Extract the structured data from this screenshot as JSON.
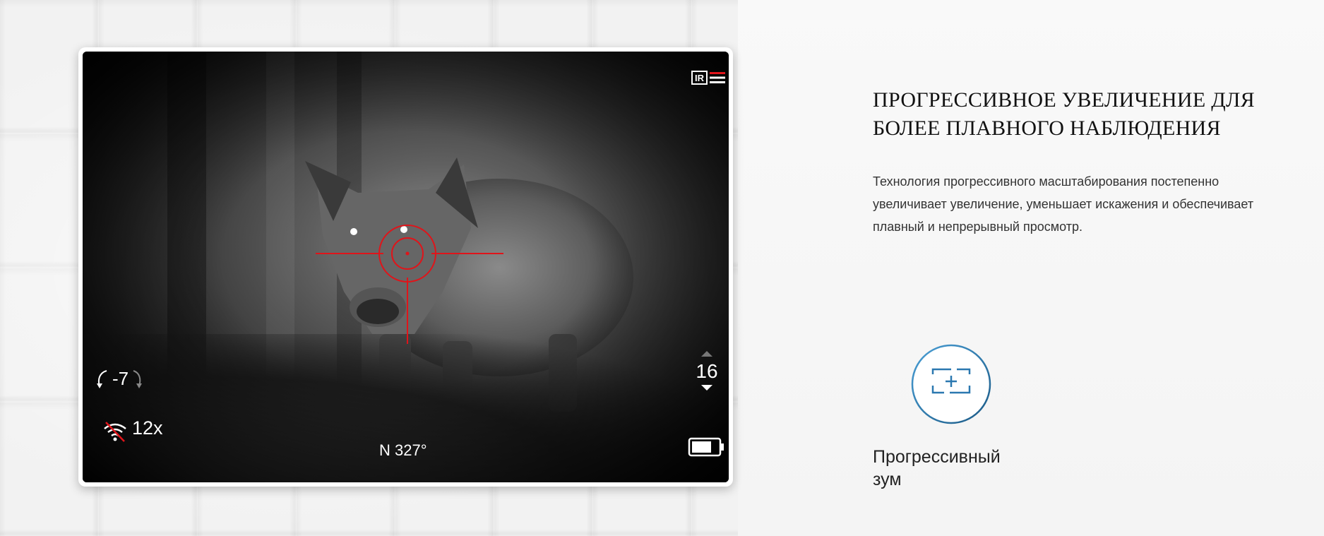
{
  "viewer": {
    "osd": {
      "ir_label": "IR",
      "tilt": "-7",
      "zoom": "12x",
      "compass": "N 327°",
      "level": "16"
    },
    "colors": {
      "reticle": "#e0141a",
      "osd_text": "#ffffff"
    }
  },
  "section": {
    "title_line1": "ПРОГРЕССИВНОЕ УВЕЛИЧЕНИЕ ДЛЯ",
    "title_line2": "БОЛЕЕ ПЛАВНОГО НАБЛЮДЕНИЯ",
    "description": "Технология прогрессивного масштабирования постепенно увеличивает увеличение, уменьшает искажения и обеспечивает плавный и непрерывный просмотр.",
    "feature": {
      "icon": "progressive-zoom-icon",
      "label_line1": "Прогрессивный",
      "label_line2": "зум"
    }
  }
}
